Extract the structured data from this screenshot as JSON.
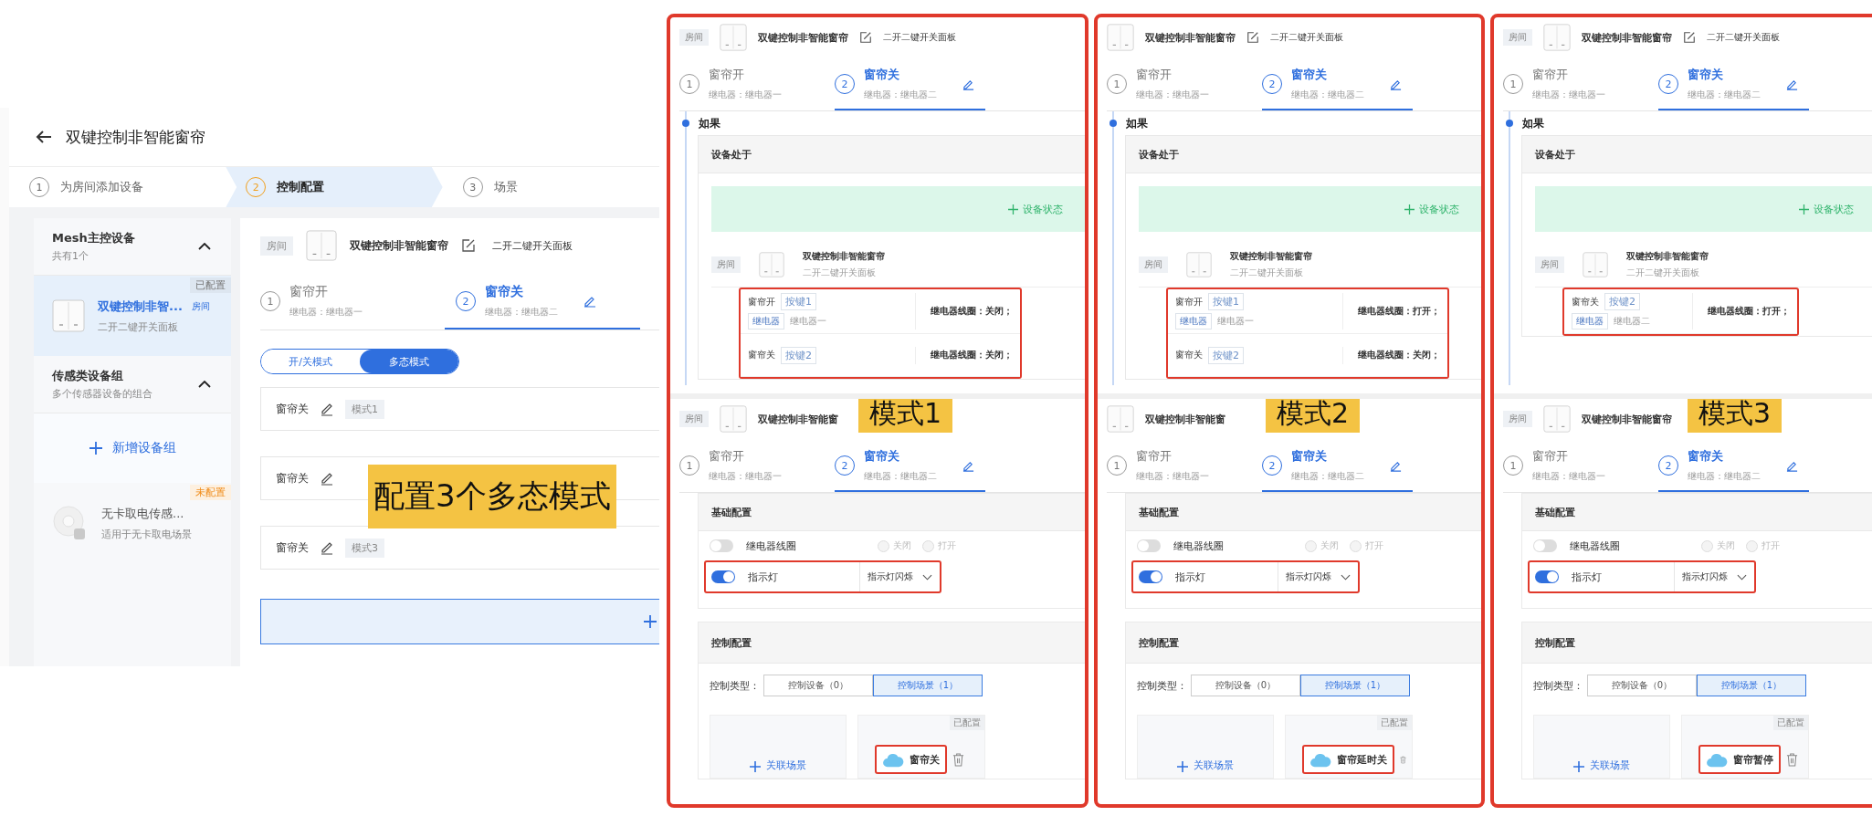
{
  "main": {
    "title": "双键控制非智能窗帘",
    "steps": [
      {
        "number": "1",
        "label": "为房间添加设备",
        "selected": false
      },
      {
        "number": "2",
        "label": "控制配置",
        "selected": true
      },
      {
        "number": "3",
        "label": "场景",
        "selected": false
      }
    ],
    "groups": [
      {
        "title": "Mesh主控设备",
        "subtitle": "共有1个",
        "expanded": true,
        "devices": [
          {
            "kind": "switch",
            "name": "双键控制非智...",
            "room": "房间",
            "model": "二开二键开关面板",
            "status": "已配置",
            "configured": true,
            "selected": true
          }
        ]
      },
      {
        "title": "传感类设备组",
        "subtitle": "多个传感器设备的组合",
        "expanded": true,
        "add_label": "新增设备组",
        "devices": [
          {
            "kind": "sensor",
            "name": "无卡取电传感...",
            "model": "适用于无卡取电场景",
            "status": "未配置",
            "configured": false,
            "selected": false
          }
        ]
      }
    ],
    "header": {
      "room": "房间",
      "name": "双键控制非智能窗帘",
      "model": "二开二键开关面板"
    },
    "tabs": [
      {
        "number": "1",
        "name": "窗帘开",
        "relay": "继电器：继电器一",
        "selected": false
      },
      {
        "number": "2",
        "name": "窗帘关",
        "relay": "继电器：继电器二",
        "selected": true
      }
    ],
    "mode_switch": [
      {
        "label": "开/关模式",
        "selected": false
      },
      {
        "label": "多态模式",
        "selected": true
      }
    ],
    "modes": [
      {
        "name": "窗帘关",
        "tag": "模式1"
      },
      {
        "name": "窗帘关"
      },
      {
        "name": "窗帘关",
        "tag": "模式3"
      }
    ],
    "callout": "配置3个多态模式"
  },
  "panels": [
    {
      "callout": "模式1",
      "top": {
        "header": {
          "room": "房间",
          "name": "双键控制非智能窗帘",
          "model": "二开二键开关面板"
        },
        "tabs": [
          {
            "number": "1",
            "name": "窗帘开",
            "relay": "继电器：继电器一",
            "selected": false
          },
          {
            "number": "2",
            "name": "窗帘关",
            "relay": "继电器：继电器二",
            "selected": true
          }
        ],
        "if_label": "如果",
        "condition_title": "设备处于",
        "add_state": "设备状态",
        "device": {
          "room": "房间",
          "name": "双键控制非智能窗帘",
          "model": "二开二键开关面板"
        },
        "conditions": [
          {
            "name": "窗帘开",
            "key": "按键1",
            "type": "继电器",
            "relay": "继电器一",
            "state": "继电器线圈：关闭；"
          },
          {
            "name": "窗帘关",
            "key": "按键2",
            "state": "继电器线圈：关闭；"
          }
        ]
      },
      "bottom": {
        "header": {
          "room": "房间",
          "name": "双键控制非智能窗"
        },
        "tabs": [
          {
            "number": "1",
            "name": "窗帘开",
            "relay": "继电器：继电器一",
            "selected": false
          },
          {
            "number": "2",
            "name": "窗帘关",
            "relay": "继电器：继电器二",
            "selected": true
          }
        ],
        "basic_title": "基础配置",
        "relay_coil": {
          "label": "继电器线圈",
          "on": false,
          "options": [
            {
              "label": "关闭",
              "selected": false
            },
            {
              "label": "打开",
              "selected": false
            }
          ]
        },
        "indicator": {
          "label": "指示灯",
          "on": true,
          "value": "指示灯闪烁"
        },
        "control_title": "控制配置",
        "control_type_label": "控制类型：",
        "control_types": [
          {
            "label": "控制设备（0）",
            "selected": false
          },
          {
            "label": "控制场景（1）",
            "selected": true
          }
        ],
        "link_scene": "关联场景",
        "scene": {
          "name": "窗帘关",
          "status": "已配置"
        }
      }
    },
    {
      "callout": "模式2",
      "top": {
        "header": {
          "name": "双键控制非智能窗帘",
          "model": "二开二键开关面板"
        },
        "tabs": [
          {
            "number": "1",
            "name": "窗帘开",
            "relay": "继电器：继电器一",
            "selected": false
          },
          {
            "number": "2",
            "name": "窗帘关",
            "relay": "继电器：继电器二",
            "selected": true
          }
        ],
        "if_label": "如果",
        "condition_title": "设备处于",
        "add_state": "设备状态",
        "device": {
          "room": "房间",
          "name": "双键控制非智能窗帘",
          "model": "二开二键开关面板"
        },
        "conditions": [
          {
            "name": "窗帘开",
            "key": "按键1",
            "type": "继电器",
            "relay": "继电器一",
            "state": "继电器线圈：打开；"
          },
          {
            "name": "窗帘关",
            "key": "按键2",
            "state": "继电器线圈：关闭；"
          }
        ]
      },
      "bottom": {
        "header": {
          "name": "双键控制非智能窗"
        },
        "tabs": [
          {
            "number": "1",
            "name": "窗帘开",
            "relay": "继电器：继电器一",
            "selected": false
          },
          {
            "number": "2",
            "name": "窗帘关",
            "relay": "继电器：继电器二",
            "selected": true
          }
        ],
        "basic_title": "基础配置",
        "relay_coil": {
          "label": "继电器线圈",
          "on": false,
          "options": [
            {
              "label": "关闭",
              "selected": false
            },
            {
              "label": "打开",
              "selected": false
            }
          ]
        },
        "indicator": {
          "label": "指示灯",
          "on": true,
          "value": "指示灯闪烁"
        },
        "control_title": "控制配置",
        "control_type_label": "控制类型：",
        "control_types": [
          {
            "label": "控制设备（0）",
            "selected": false
          },
          {
            "label": "控制场景（1）",
            "selected": true
          }
        ],
        "link_scene": "关联场景",
        "scene": {
          "name": "窗帘延时关",
          "status": "已配置"
        }
      }
    },
    {
      "callout": "模式3",
      "top": {
        "header": {
          "room": "房间",
          "name": "双键控制非智能窗帘",
          "model": "二开二键开关面板"
        },
        "tabs": [
          {
            "number": "1",
            "name": "窗帘开",
            "relay": "继电器：继电器一",
            "selected": false
          },
          {
            "number": "2",
            "name": "窗帘关",
            "relay": "继电器：继电器二",
            "selected": true
          }
        ],
        "if_label": "如果",
        "condition_title": "设备处于",
        "add_state": "设备状态",
        "device": {
          "room": "房间",
          "name": "双键控制非智能窗帘",
          "model": "二开二键开关面板"
        },
        "conditions": [
          {
            "name": "窗帘关",
            "key": "按键2",
            "type": "继电器",
            "relay": "继电器二",
            "state": "继电器线圈：打开；"
          }
        ]
      },
      "bottom": {
        "header": {
          "room": "房间",
          "name": "双键控制非智能窗帘"
        },
        "tabs": [
          {
            "number": "1",
            "name": "窗帘开",
            "relay": "继电器：继电器一",
            "selected": false
          },
          {
            "number": "2",
            "name": "窗帘关",
            "relay": "继电器：继电器二",
            "selected": true
          }
        ],
        "basic_title": "基础配置",
        "relay_coil": {
          "label": "继电器线圈",
          "on": false,
          "options": [
            {
              "label": "关闭",
              "selected": false
            },
            {
              "label": "打开",
              "selected": false
            }
          ]
        },
        "indicator": {
          "label": "指示灯",
          "on": true,
          "value": "指示灯闪烁"
        },
        "control_title": "控制配置",
        "control_type_label": "控制类型：",
        "control_types": [
          {
            "label": "控制设备（0）",
            "selected": false
          },
          {
            "label": "控制场景（1）",
            "selected": true
          }
        ],
        "link_scene": "关联场景",
        "scene": {
          "name": "窗帘暂停",
          "status": "已配置"
        }
      }
    }
  ]
}
